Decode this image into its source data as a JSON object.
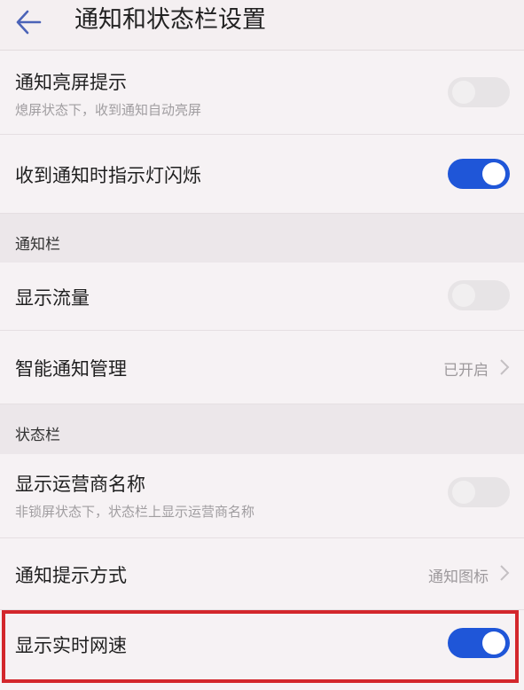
{
  "header": {
    "title": "通知和状态栏设置"
  },
  "rows": {
    "notify_wake": {
      "label": "通知亮屏提示",
      "sub": "熄屏状态下，收到通知自动亮屏",
      "toggle": "off"
    },
    "led_blink": {
      "label": "收到通知时指示灯闪烁",
      "toggle": "on"
    },
    "show_traffic": {
      "label": "显示流量",
      "toggle": "off"
    },
    "smart_notify": {
      "label": "智能通知管理",
      "value": "已开启"
    },
    "carrier_name": {
      "label": "显示运营商名称",
      "sub": "非锁屏状态下，状态栏上显示运营商名称",
      "toggle": "off"
    },
    "notify_style": {
      "label": "通知提示方式",
      "value": "通知图标"
    },
    "net_speed": {
      "label": "显示实时网速",
      "toggle": "on"
    }
  },
  "sections": {
    "notification_bar": "通知栏",
    "status_bar": "状态栏"
  },
  "colors": {
    "toggle_on": "#1f56d8",
    "highlight": "#d3272c"
  }
}
